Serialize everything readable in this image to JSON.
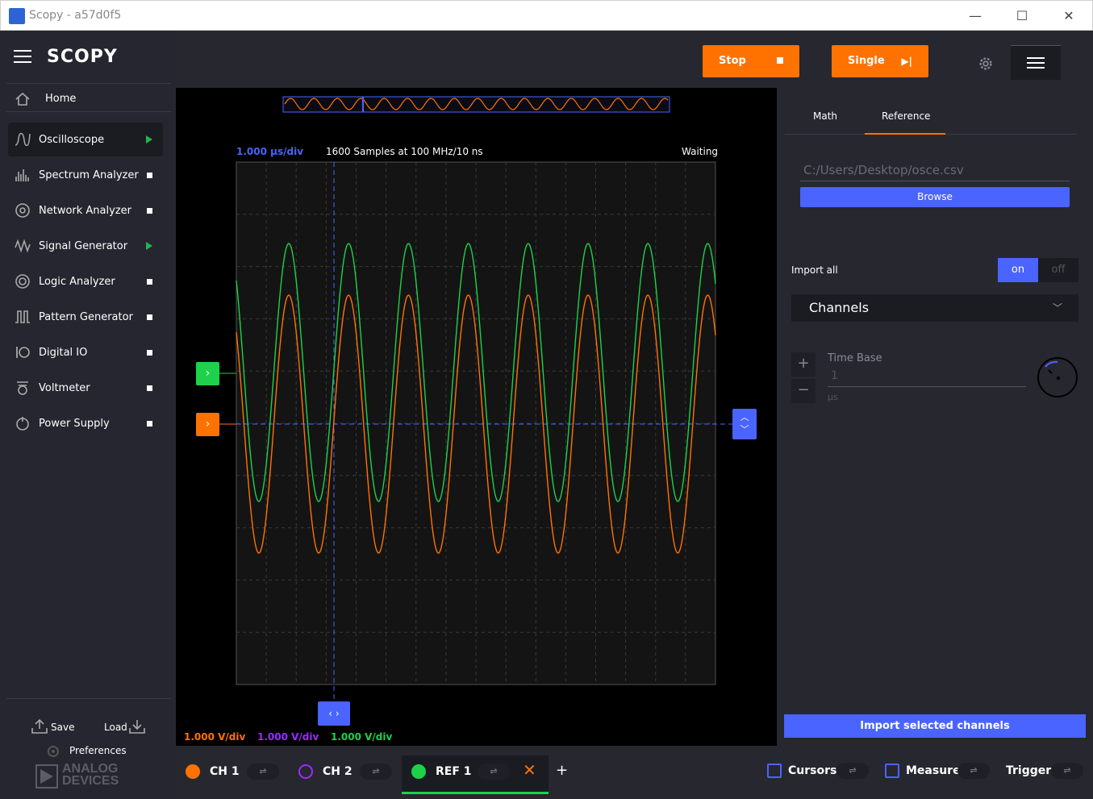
{
  "window": {
    "title": "Scopy - a57d0f5",
    "controls": {
      "minimize": "—",
      "maximize": "☐",
      "close": "✕"
    }
  },
  "sidebar": {
    "logo": "SCOPY",
    "home": "Home",
    "items": [
      {
        "label": "Oscilloscope",
        "indicator": "running"
      },
      {
        "label": "Spectrum Analyzer",
        "indicator": "stopped"
      },
      {
        "label": "Network Analyzer",
        "indicator": "stopped"
      },
      {
        "label": "Signal Generator",
        "indicator": "running"
      },
      {
        "label": "Logic Analyzer",
        "indicator": "stopped"
      },
      {
        "label": "Pattern Generator",
        "indicator": "stopped"
      },
      {
        "label": "Digital IO",
        "indicator": "stopped"
      },
      {
        "label": "Voltmeter",
        "indicator": "stopped"
      },
      {
        "label": "Power Supply",
        "indicator": "stopped"
      }
    ],
    "save": "Save",
    "load": "Load",
    "preferences": "Preferences",
    "brand_line1": "ANALOG",
    "brand_line2": "DEVICES"
  },
  "toolbar": {
    "stop_label": "Stop",
    "single_label": "Single"
  },
  "plot": {
    "time_div": "1.000 µs/div",
    "samples": "1600 Samples at 100 MHz/10 ns",
    "status": "Waiting",
    "ch1_vdiv": "1.000 V/div",
    "ch2_vdiv": "1.000 V/div",
    "ref1_vdiv": "1.000 V/div"
  },
  "right_panel": {
    "tabs": [
      "Math",
      "Reference"
    ],
    "active_tab": "Reference",
    "file_path": "C:/Users/Desktop/osce.csv",
    "browse": "Browse",
    "import_all": "Import all",
    "toggle_on": "on",
    "toggle_off": "off",
    "channels": "Channels",
    "time_base_label": "Time Base",
    "time_base_value": "1",
    "time_base_unit": "µs",
    "import_button": "Import selected channels"
  },
  "bottom": {
    "channels": [
      {
        "label": "CH 1",
        "color": "#ff7200"
      },
      {
        "label": "CH 2",
        "color": "#9b2bff"
      },
      {
        "label": "REF 1",
        "color": "#1dd14a"
      }
    ],
    "cursors": "Cursors",
    "measure": "Measure",
    "trigger": "Trigger"
  },
  "colors": {
    "accent_orange": "#ff7200",
    "accent_blue": "#4a64ff",
    "ref_green": "#1dd14a",
    "ch2_purple": "#9b2bff"
  }
}
